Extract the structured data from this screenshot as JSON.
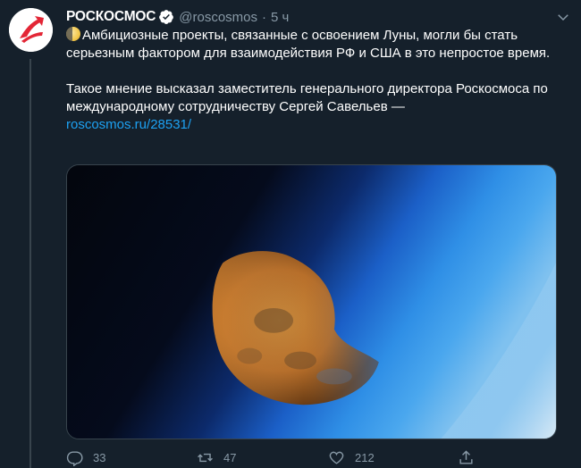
{
  "tweet": {
    "author_name": "РОСКОСМОС",
    "handle": "@roscosmos",
    "separator": "·",
    "time": "5 ч",
    "text_line1": "Амбициозные проекты, связанные с освоением Луны, могли бы стать серьезным фактором для взаимодействия РФ и США в это непростое время.",
    "text_line2": "Такое мнение высказал заместитель генерального директора Роскосмоса по международному сотрудничеству Сергей Савельев —",
    "link_text": "roscosmos.ru/28531/"
  },
  "actions": {
    "replies": "33",
    "retweets": "47",
    "likes": "212"
  },
  "icons": {
    "avatar": "roscosmos-logo-icon",
    "verified": "verified-badge-icon",
    "menu": "chevron-down-icon",
    "reply": "reply-icon",
    "retweet": "retweet-icon",
    "like": "heart-icon",
    "share": "share-icon",
    "emoji": "moon-emoji-icon"
  },
  "colors": {
    "background": "#15202b",
    "secondary_text": "#8899a6",
    "link": "#1da1f2",
    "brand_red": "#e32636"
  }
}
